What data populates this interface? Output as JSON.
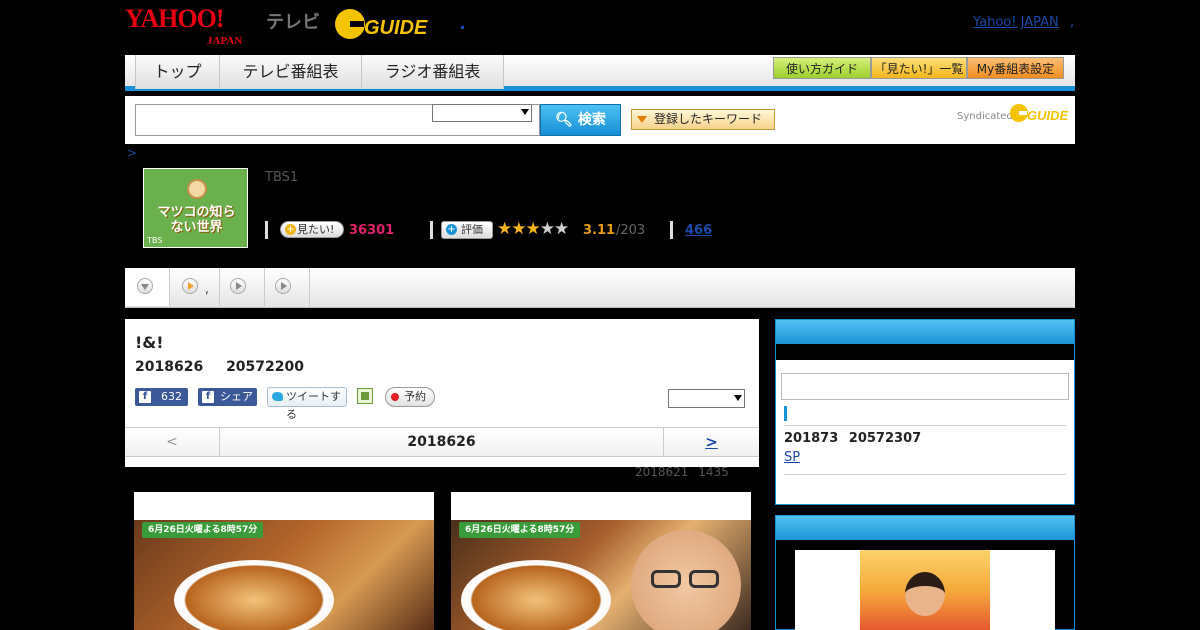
{
  "header": {
    "yahoo_logo": "YAHOO!",
    "yahoo_logo_sub": "JAPAN",
    "tv_label": "テレビ",
    "gguide_logo": "G-GUIDE",
    "yahoo_japan_link": "Yahoo! JAPAN",
    "link_dot": ","
  },
  "nav": {
    "tabs": [
      "トップ",
      "テレビ番組表",
      "ラジオ番組表"
    ],
    "utility": [
      "使い方ガイド",
      "「見たい!」一覧",
      "My番組表設定"
    ]
  },
  "search": {
    "button_label": "検索",
    "keyword_button": "登録したキーワード",
    "syndicated_label": "Syndicated"
  },
  "breadcrumb": {
    "separator": ">"
  },
  "program": {
    "thumb_title": "マツコの知らない世界",
    "thumb_channel": "TBS",
    "channel": "TBS1",
    "mitai_label": "見たい!",
    "mitai_count": "36301",
    "rate_label": "評価",
    "rating": 3.11,
    "rating_display": "3.11",
    "rating_count": "/203",
    "review_count": "466",
    "stars_total": 5
  },
  "tabbar": {
    "tab2_text": ","
  },
  "main": {
    "title": "!&!",
    "date_line": "2018626 20572200",
    "fb_count": "632",
    "fb_share": "シェア",
    "tweet": "ツイートする",
    "reserve": "予約",
    "pager_prev": "<",
    "pager_current": "2018626",
    "pager_next": ">",
    "updated": "2018621 1435"
  },
  "photos": [
    {
      "banner": "6月26日火曜よる8時57分"
    },
    {
      "banner": "6月26日火曜よる8時57分"
    }
  ],
  "side": {
    "date_line": "201873 20572307",
    "link": "SP"
  },
  "colors": {
    "accent_blue": "#1a93d6",
    "link_blue": "#1b49a8",
    "mitai_pink": "#e0226e",
    "star_gold": "#f2b51c"
  }
}
